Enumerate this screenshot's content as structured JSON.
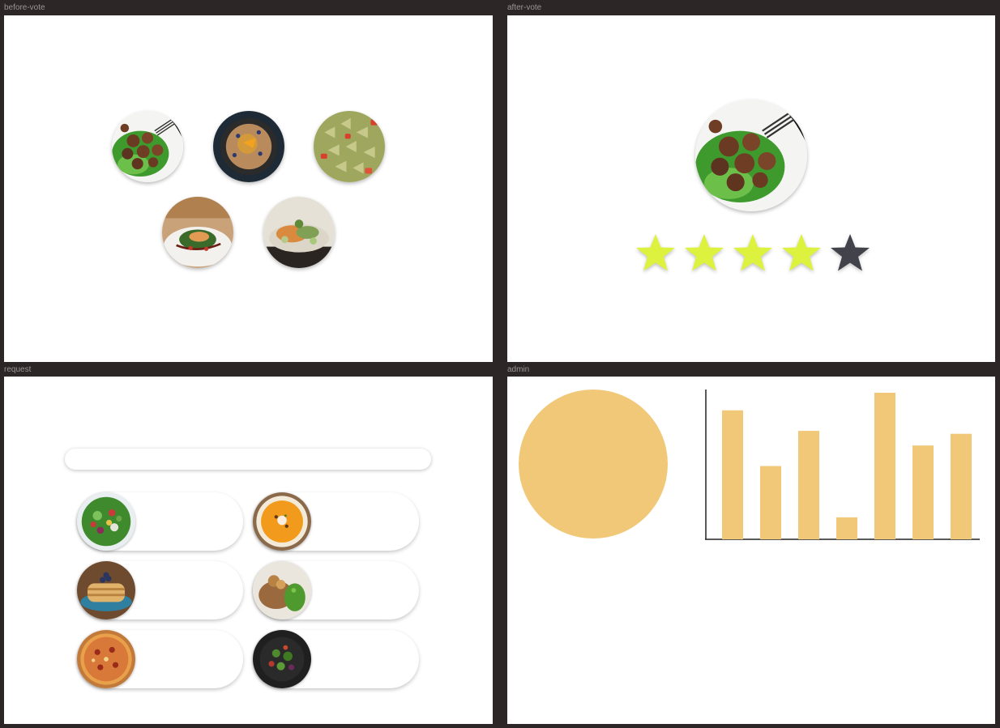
{
  "frames": {
    "before_vote": "before-vote",
    "after_vote": "after-vote",
    "request": "request",
    "admin": "admin"
  },
  "before_vote": {
    "dishes": [
      "meatball-salad",
      "fruit-oatmeal",
      "farfalle-pasta",
      "plated-salmon",
      "fish-with-vegetables"
    ]
  },
  "after_vote": {
    "selected_dish": "meatball-salad",
    "rating": {
      "value": 4,
      "max": 5
    },
    "colors": {
      "filled": "#dcf23f",
      "empty": "#41424a"
    }
  },
  "request": {
    "search": {
      "placeholder": "",
      "value": ""
    },
    "items": [
      {
        "dish": "green-salad",
        "label": ""
      },
      {
        "dish": "pumpkin-soup",
        "label": ""
      },
      {
        "dish": "blueberry-pancakes",
        "label": ""
      },
      {
        "dish": "meat-with-greens",
        "label": ""
      },
      {
        "dish": "pizza",
        "label": ""
      },
      {
        "dish": "dark-plate-salad",
        "label": ""
      }
    ]
  },
  "admin": {
    "colors": {
      "accent": "#f1c778",
      "axis": "#222222"
    },
    "chart_data": [
      {
        "type": "pie",
        "values": [
          100
        ]
      },
      {
        "type": "bar",
        "values": [
          88,
          50,
          74,
          15,
          100,
          64,
          72
        ],
        "ylim": [
          0,
          100
        ]
      }
    ]
  }
}
